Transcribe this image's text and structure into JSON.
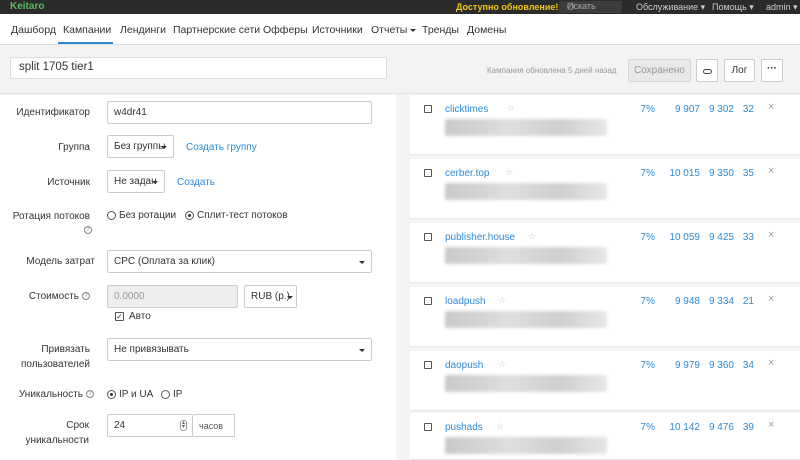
{
  "topbar": {
    "logo": "Keitaro",
    "update": "Доступно обновление!",
    "search_placeholder": "Искать",
    "menu_service": "Обслуживание ▾",
    "menu_help": "Помощь ▾",
    "menu_user": "admin ▾"
  },
  "nav": {
    "items": [
      "Дашборд",
      "Кампании",
      "Лендинги",
      "Партнерские сети",
      "Офферы",
      "Источники",
      "Отчеты",
      "Тренды",
      "Домены"
    ],
    "active": "Кампании"
  },
  "campaign": {
    "name": "split 1705 tier1",
    "updated": "Кампания обновлена 5 дней назад",
    "saved_label": "Сохранено",
    "log_label": "Лог",
    "more_label": "···"
  },
  "form": {
    "id_label": "Идентификатор",
    "id_value": "w4dr41",
    "group_label": "Группа",
    "group_value": "Без группы",
    "group_create": "Создать группу",
    "source_label": "Источник",
    "source_value": "Не задан",
    "source_create": "Создать",
    "rotation_label": "Ротация потоков",
    "rotation_opt1": "Без ротации",
    "rotation_opt2": "Сплит-тест потоков",
    "rotation_selected": "Сплит-тест потоков",
    "cost_model_label": "Модель затрат",
    "cost_model_value": "CPC (Оплата за клик)",
    "cost_label": "Стоимость",
    "cost_value": "0.0000",
    "currency_value": "RUB (р.)",
    "auto_label": "Авто",
    "auto_checked": true,
    "bind_label_1": "Привязать",
    "bind_label_2": "пользователей",
    "bind_value": "Не привязывать",
    "uniq_label": "Уникальность",
    "uniq_opt1": "IP и UA",
    "uniq_opt2": "IP",
    "uniq_selected": "IP и UA",
    "term_label_1": "Срок",
    "term_label_2": "уникальности",
    "term_value": "24",
    "term_unit": "часов"
  },
  "streams": [
    {
      "name": "clicktimes",
      "pct": "7%",
      "v1": "9 907",
      "v2": "9 302",
      "v3": "32"
    },
    {
      "name": "cerber.top",
      "pct": "7%",
      "v1": "10 015",
      "v2": "9 350",
      "v3": "35"
    },
    {
      "name": "publisher.house",
      "pct": "7%",
      "v1": "10 059",
      "v2": "9 425",
      "v3": "33"
    },
    {
      "name": "loadpush",
      "pct": "7%",
      "v1": "9 948",
      "v2": "9 334",
      "v3": "21"
    },
    {
      "name": "daopush",
      "pct": "7%",
      "v1": "9 979",
      "v2": "9 360",
      "v3": "34"
    },
    {
      "name": "pushads",
      "pct": "7%",
      "v1": "10 142",
      "v2": "9 476",
      "v3": "39"
    }
  ],
  "icons": {
    "star": "☆",
    "close": "×"
  },
  "colors": {
    "accent": "#2d8ad6",
    "logo": "#5cb85c",
    "update": "#f0c419",
    "topbar": "#2b2b2b"
  }
}
